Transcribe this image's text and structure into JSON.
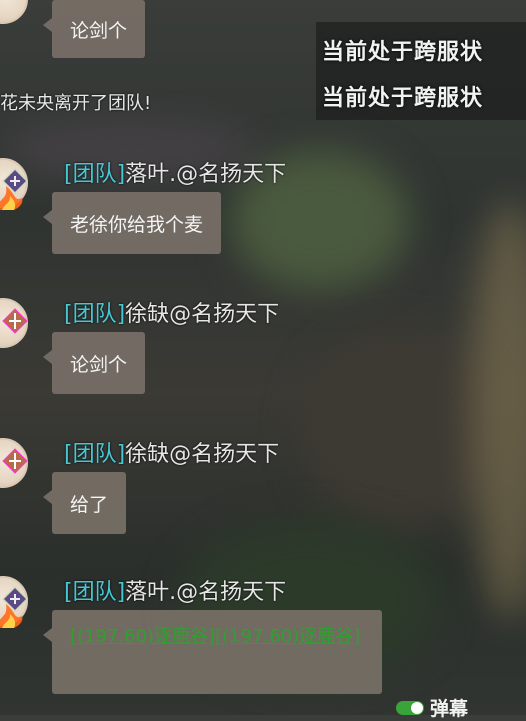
{
  "top_notice": [
    "当前处于跨服状",
    "当前处于跨服状"
  ],
  "system_message": "花未央离开了团队!",
  "top_partial_bubble": "论剑个",
  "messages": [
    {
      "channel": "[团队]",
      "sender": "落叶.@名扬天下",
      "text": "老徐你给我个麦"
    },
    {
      "channel": "[团队]",
      "sender": "徐缺@名扬天下",
      "text": "论剑个"
    },
    {
      "channel": "[团队]",
      "sender": "徐缺@名扬天下",
      "text": "给了"
    },
    {
      "channel": "[团队]",
      "sender": "落叶.@名扬天下",
      "links": [
        "[(197.60)逐鹿谷]",
        "[(197.60)逐鹿谷]"
      ]
    }
  ],
  "danmu": {
    "label": "弹幕",
    "enabled": true
  },
  "colors": {
    "channel": "#47c7d4",
    "link": "#2fa02f",
    "bubble": "#787067"
  }
}
